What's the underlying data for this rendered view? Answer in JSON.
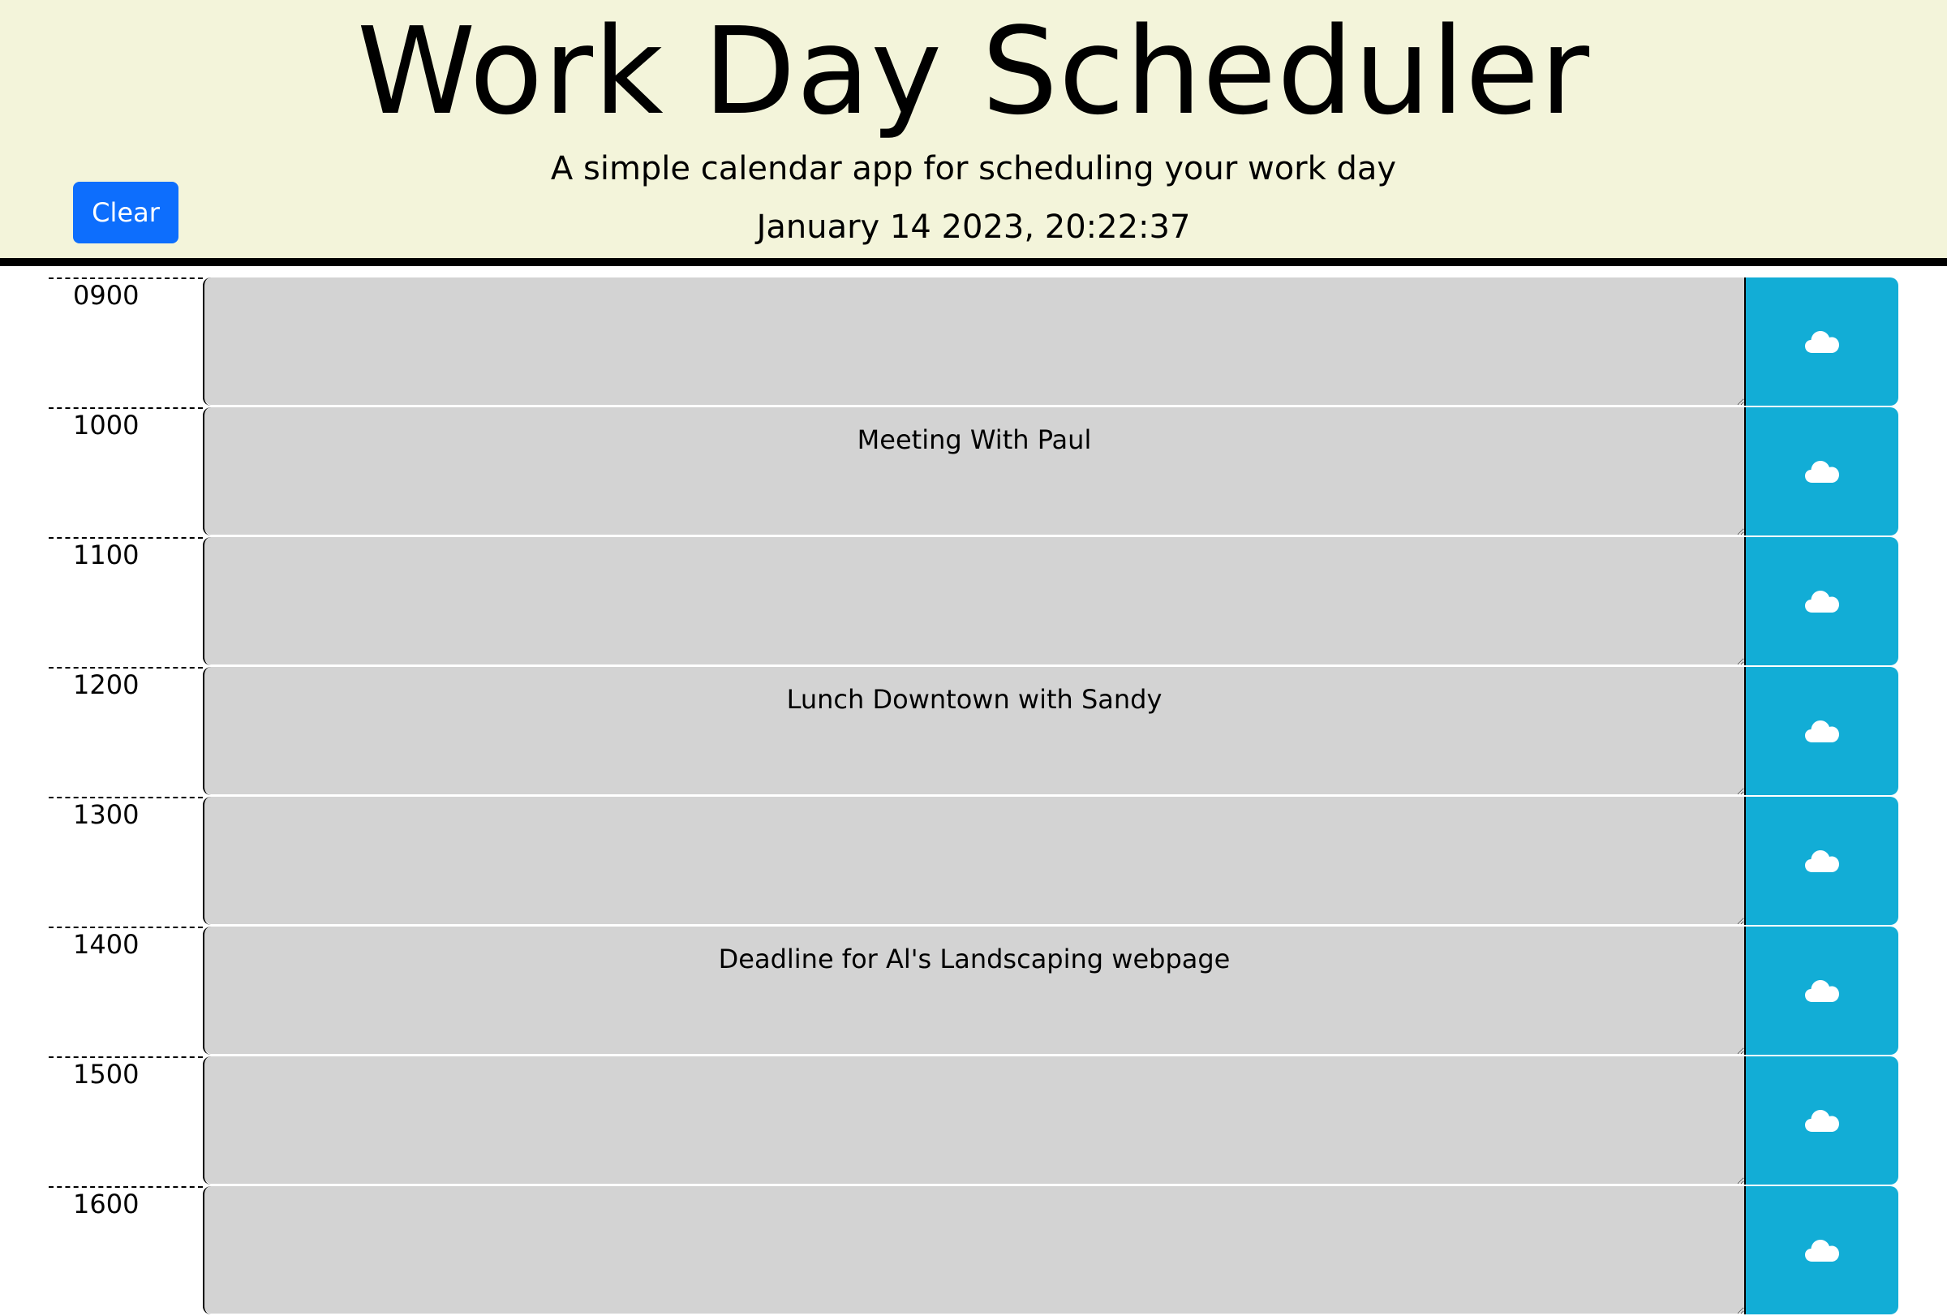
{
  "header": {
    "title": "Work Day Scheduler",
    "subtitle": "A simple calendar app for scheduling your work day",
    "clock": "January 14 2023, 20:22:37",
    "clear_label": "Clear"
  },
  "colors": {
    "header_background": "#f3f4da",
    "clear_button": "#0d6efd",
    "past_block": "#d3d3d3",
    "save_button": "#12add6"
  },
  "rows": [
    {
      "hour": "0900",
      "text": "",
      "save_icon": "cloud-icon"
    },
    {
      "hour": "1000",
      "text": "Meeting With Paul",
      "save_icon": "cloud-icon"
    },
    {
      "hour": "1100",
      "text": "",
      "save_icon": "cloud-icon"
    },
    {
      "hour": "1200",
      "text": "Lunch Downtown with Sandy",
      "save_icon": "cloud-icon"
    },
    {
      "hour": "1300",
      "text": "",
      "save_icon": "cloud-icon"
    },
    {
      "hour": "1400",
      "text": "Deadline for Al's Landscaping webpage",
      "save_icon": "cloud-icon"
    },
    {
      "hour": "1500",
      "text": "",
      "save_icon": "cloud-icon"
    },
    {
      "hour": "1600",
      "text": "",
      "save_icon": "cloud-icon"
    }
  ]
}
